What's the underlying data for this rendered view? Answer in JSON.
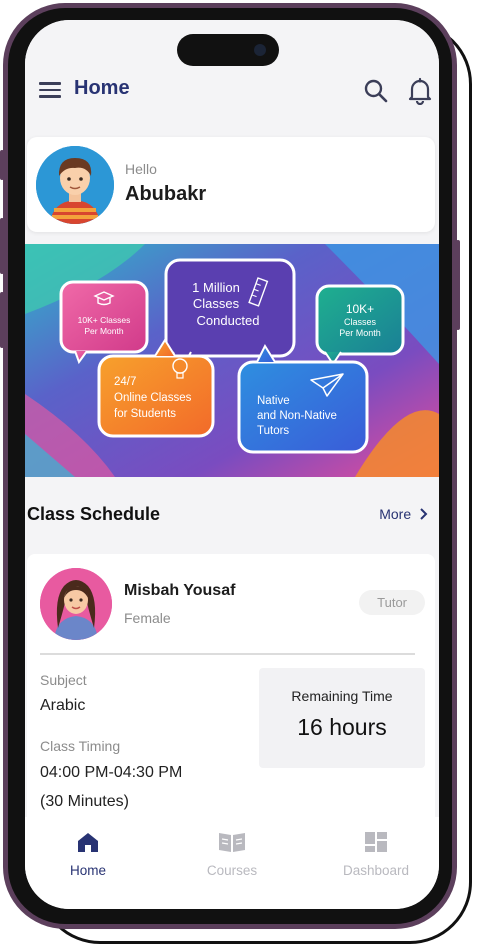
{
  "header": {
    "title": "Home"
  },
  "greeting": {
    "hello": "Hello",
    "name": "Abubakr"
  },
  "banner": {
    "bubbles": [
      {
        "line1": "10K+ Classes",
        "line2": "Per Month"
      },
      {
        "line1": "1 Million",
        "line2": "Classes",
        "line3": "Conducted"
      },
      {
        "line1": "10K+",
        "line2": "Classes",
        "line3": "Per Month"
      },
      {
        "line1": "24/7",
        "line2": "Online Classes",
        "line3": "for Students"
      },
      {
        "line1": "Native",
        "line2": "and Non-Native",
        "line3": "Tutors"
      }
    ]
  },
  "schedule": {
    "title": "Class Schedule",
    "more_label": "More",
    "tutor": {
      "name": "Misbah Yousaf",
      "gender": "Female",
      "badge": "Tutor"
    },
    "subject_label": "Subject",
    "subject": "Arabic",
    "timing_label": "Class Timing",
    "timing": "04:00 PM-04:30 PM",
    "duration": "(30 Minutes)",
    "remaining_label": "Remaining Time",
    "remaining_value": "16 hours"
  },
  "nav": {
    "items": [
      {
        "label": "Home",
        "icon": "home-icon",
        "active": true
      },
      {
        "label": "Courses",
        "icon": "book-icon",
        "active": false
      },
      {
        "label": "Dashboard",
        "icon": "dashboard-icon",
        "active": false
      }
    ]
  },
  "colors": {
    "primary": "#283373",
    "frame": "#5c3f5c",
    "inactive": "#b9b9bf"
  }
}
